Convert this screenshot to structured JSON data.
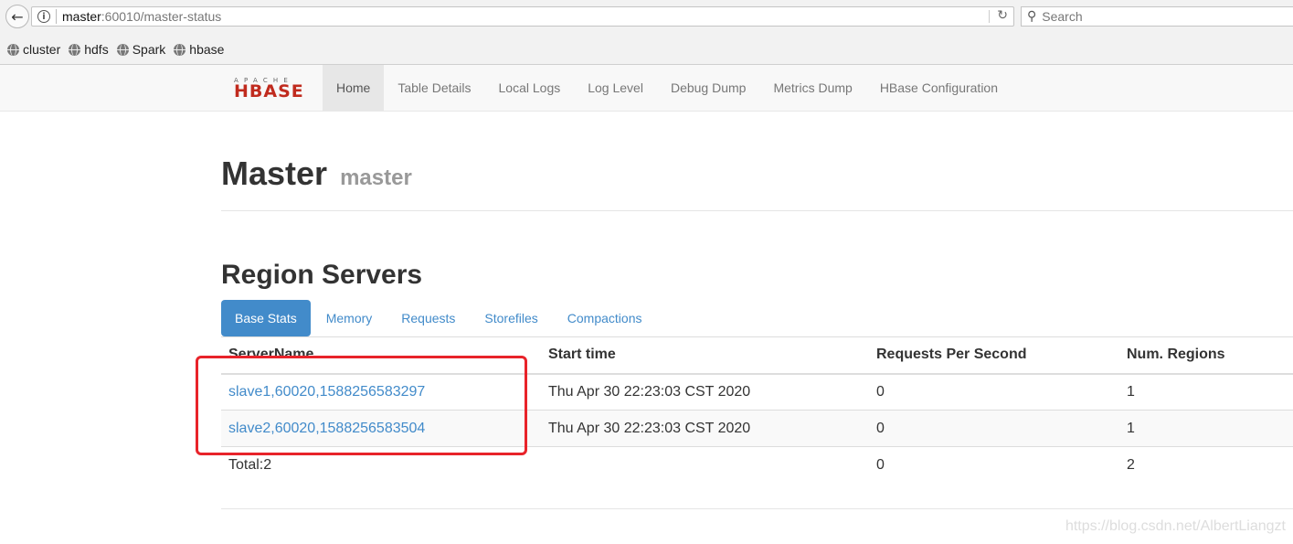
{
  "browser": {
    "url_host": "master",
    "url_rest": ":60010/master-status",
    "search_placeholder": "Search",
    "bookmarks": [
      "cluster",
      "hdfs",
      "Spark",
      "hbase"
    ]
  },
  "navbar": {
    "logo_top": "APACHE",
    "logo_main": "HBASE",
    "items": [
      "Home",
      "Table Details",
      "Local Logs",
      "Log Level",
      "Debug Dump",
      "Metrics Dump",
      "HBase Configuration"
    ],
    "active": "Home"
  },
  "page": {
    "title": "Master",
    "subtitle": "master"
  },
  "region_servers": {
    "title": "Region Servers",
    "tabs": [
      "Base Stats",
      "Memory",
      "Requests",
      "Storefiles",
      "Compactions"
    ],
    "active_tab": "Base Stats",
    "columns": [
      "ServerName",
      "Start time",
      "Requests Per Second",
      "Num. Regions"
    ],
    "rows": [
      {
        "server": "slave1,60020,1588256583297",
        "start": "Thu Apr 30 22:23:03 CST 2020",
        "rps": "0",
        "regions": "1"
      },
      {
        "server": "slave2,60020,1588256583504",
        "start": "Thu Apr 30 22:23:03 CST 2020",
        "rps": "0",
        "regions": "1"
      }
    ],
    "total": {
      "label": "Total:2",
      "rps": "0",
      "regions": "2"
    }
  },
  "watermark": "https://blog.csdn.net/AlbertLiangzt",
  "colors": {
    "accent": "#428bca",
    "highlight": "#e8232a",
    "logo": "#c02b1e"
  }
}
